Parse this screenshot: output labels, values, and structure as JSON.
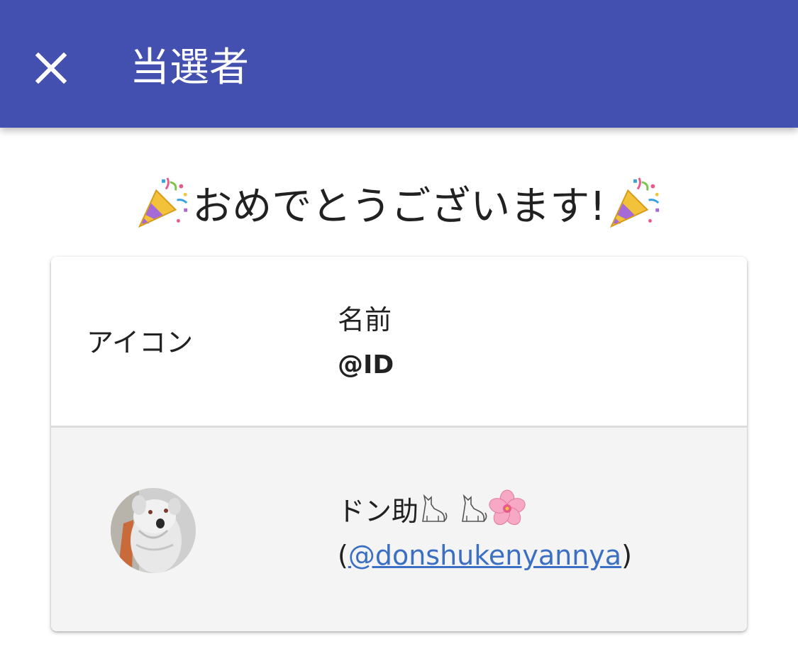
{
  "appbar": {
    "title": "当選者",
    "close_icon": "close-icon",
    "background": "#4350af"
  },
  "congrats": {
    "text": "おめでとうございます!",
    "emoji_icon": "party-popper-icon"
  },
  "table": {
    "headers": {
      "icon_label": "アイコン",
      "name_label": "名前",
      "id_label": "@ID"
    },
    "rows": [
      {
        "name": "ドン助",
        "name_emoji_icons": [
          "cat-icon",
          "cat-icon",
          "cherry-blossom-icon"
        ],
        "id_open": "(",
        "id_handle": "@donshukenyannya",
        "id_close": ")"
      }
    ]
  },
  "colors": {
    "link": "#3b6fc4",
    "row_background": "#f4f4f4"
  }
}
